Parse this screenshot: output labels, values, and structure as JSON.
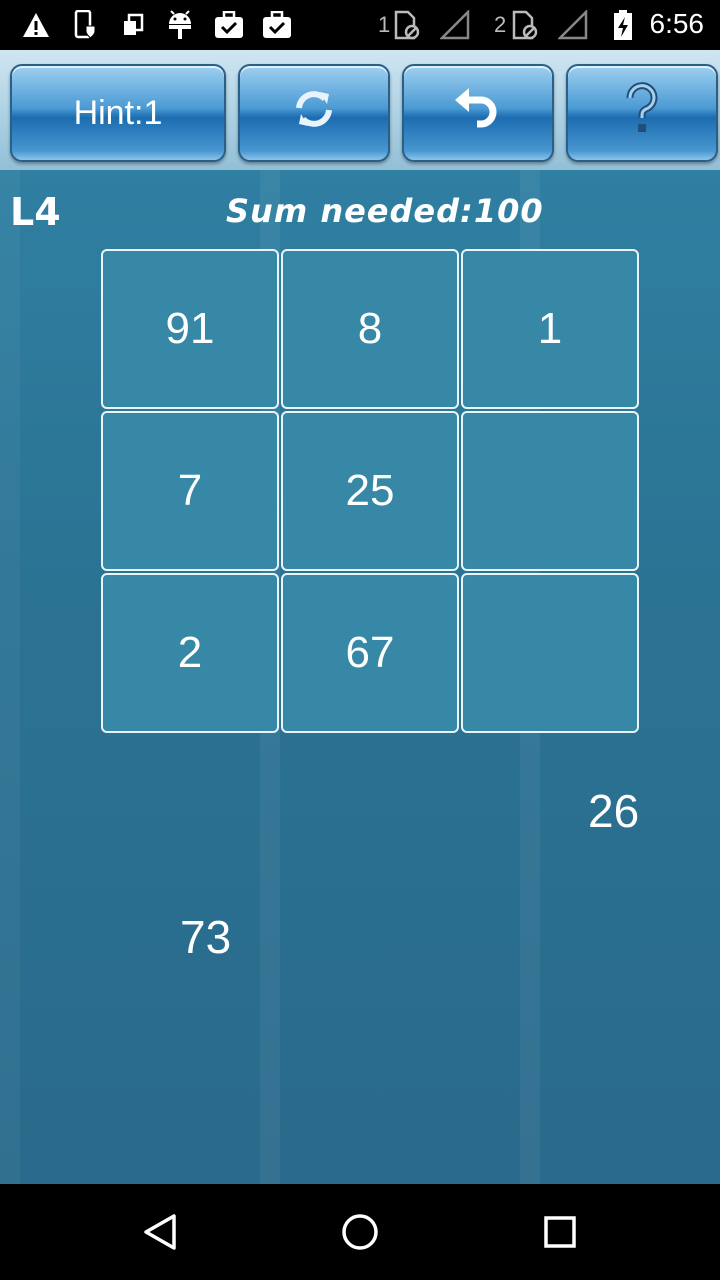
{
  "status_bar": {
    "time": "6:56",
    "sim1_label": "1",
    "sim2_label": "2",
    "icons": [
      "warning-icon",
      "phone-shield-icon",
      "copy-icon",
      "android-icon",
      "briefcase-check-icon",
      "briefcase-check-icon",
      "sim-off-icon",
      "signal-empty-icon",
      "sim-off-icon",
      "signal-empty-icon",
      "battery-charging-icon"
    ]
  },
  "toolbar": {
    "hint_label": "Hint:1",
    "refresh_icon": "refresh-icon",
    "undo_icon": "undo-icon",
    "help_icon": "help-icon"
  },
  "game": {
    "level": "L4",
    "sum_needed": "Sum needed:100",
    "grid": [
      [
        "91",
        "8",
        "1"
      ],
      [
        "7",
        "25",
        ""
      ],
      [
        "2",
        "67",
        ""
      ]
    ],
    "loose_tiles": [
      "26",
      "73"
    ]
  },
  "nav_bar": {
    "icons": [
      "back-triangle-icon",
      "home-circle-icon",
      "recents-square-icon"
    ]
  },
  "colors": {
    "background": "#2a6d8f",
    "cell": "#3688a6",
    "button": "#1c6cb0"
  }
}
